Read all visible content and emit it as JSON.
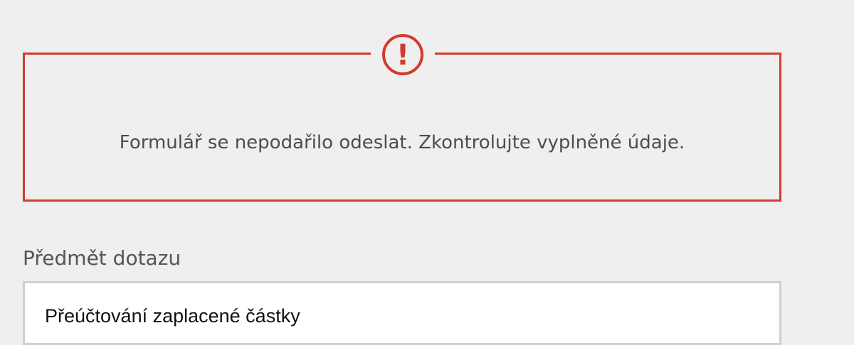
{
  "colors": {
    "background": "#efefef",
    "error_accent": "#d33a2c",
    "text_primary": "#4d4d4d",
    "input_border": "#cfcfcf",
    "input_background": "#ffffff"
  },
  "error_box": {
    "icon": "exclamation-circle-icon",
    "icon_symbol": "!",
    "message": "Formulář se nepodařilo odeslat. Zkontrolujte vyplněné údaje."
  },
  "form": {
    "subject": {
      "label": "Předmět dotazu",
      "value": "Přeúčtování zaplacené částky"
    }
  }
}
